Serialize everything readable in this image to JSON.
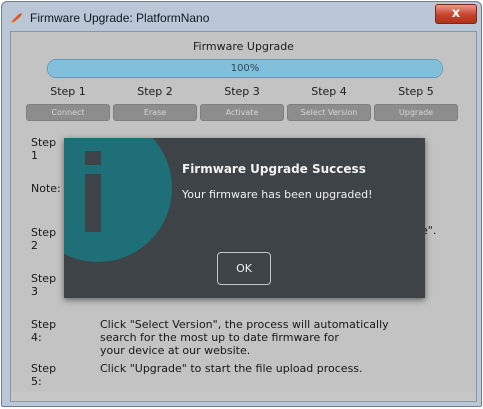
{
  "window": {
    "title": "Firmware Upgrade: PlatformNano",
    "close_label": "x",
    "icon": "app-icon"
  },
  "header": {
    "title": "Firmware Upgrade"
  },
  "progress": {
    "value": 1.0,
    "label": "100%",
    "color": "#8cd0ee"
  },
  "steps": [
    {
      "label": "Step 1",
      "button": "Connect"
    },
    {
      "label": "Step 2",
      "button": "Erase"
    },
    {
      "label": "Step 3",
      "button": "Activate"
    },
    {
      "label": "Step 4",
      "button": "Select Version"
    },
    {
      "label": "Step 5",
      "button": "Upgrade"
    }
  ],
  "instructions": {
    "step1_label": "Step 1",
    "note_label": "Note:",
    "step2_label": "Step 2",
    "step3_label": "Step 3",
    "step4_label": "Step 4:",
    "step4_text": "Click \"Select Version\", the process will automatically\nsearch for the most up to date firmware for\nyour device at our website.",
    "step5_label": "Step 5:",
    "step5_text": "Click \"Upgrade\" to start the file upload process.",
    "partial_tail": "e\"."
  },
  "dialog": {
    "title": "Firmware Upgrade Success",
    "message": "Your firmware has been upgraded!",
    "ok_label": "OK",
    "icon": "info-icon",
    "icon_color": "#1f6f78",
    "background": "#3d4347"
  }
}
